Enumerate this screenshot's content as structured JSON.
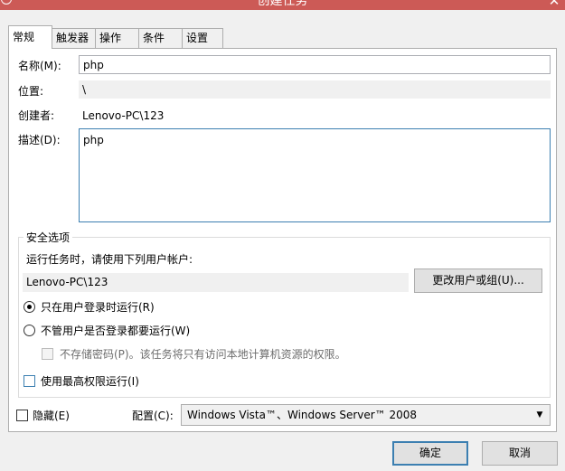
{
  "window": {
    "title": "创建任务"
  },
  "tabs": [
    "常规",
    "触发器",
    "操作",
    "条件",
    "设置"
  ],
  "general": {
    "name_label": "名称(M):",
    "name_value": "php",
    "location_label": "位置:",
    "location_value": "\\",
    "author_label": "创建者:",
    "author_value": "Lenovo-PC\\123",
    "description_label": "描述(D):",
    "description_value": "php"
  },
  "security": {
    "group_title": "安全选项",
    "run_as_prompt": "运行任务时，请使用下列用户帐户:",
    "user_account": "Lenovo-PC\\123",
    "change_user_button": "更改用户或组(U)...",
    "radio_logged_on": "只在用户登录时运行(R)",
    "radio_logged_on_selected": true,
    "radio_whether_logged_on": "不管用户是否登录都要运行(W)",
    "no_store_password": "不存储密码(P)。该任务将只有访问本地计算机资源的权限。",
    "highest_privileges": "使用最高权限运行(I)"
  },
  "bottom": {
    "hidden_label": "隐藏(E)",
    "configure_label": "配置(C):",
    "configure_value": "Windows Vista™、Windows Server™ 2008"
  },
  "buttons": {
    "ok": "确定",
    "cancel": "取消"
  },
  "colors": {
    "titlebar": "#cc5a56",
    "focus_border": "#3c7fb1"
  }
}
